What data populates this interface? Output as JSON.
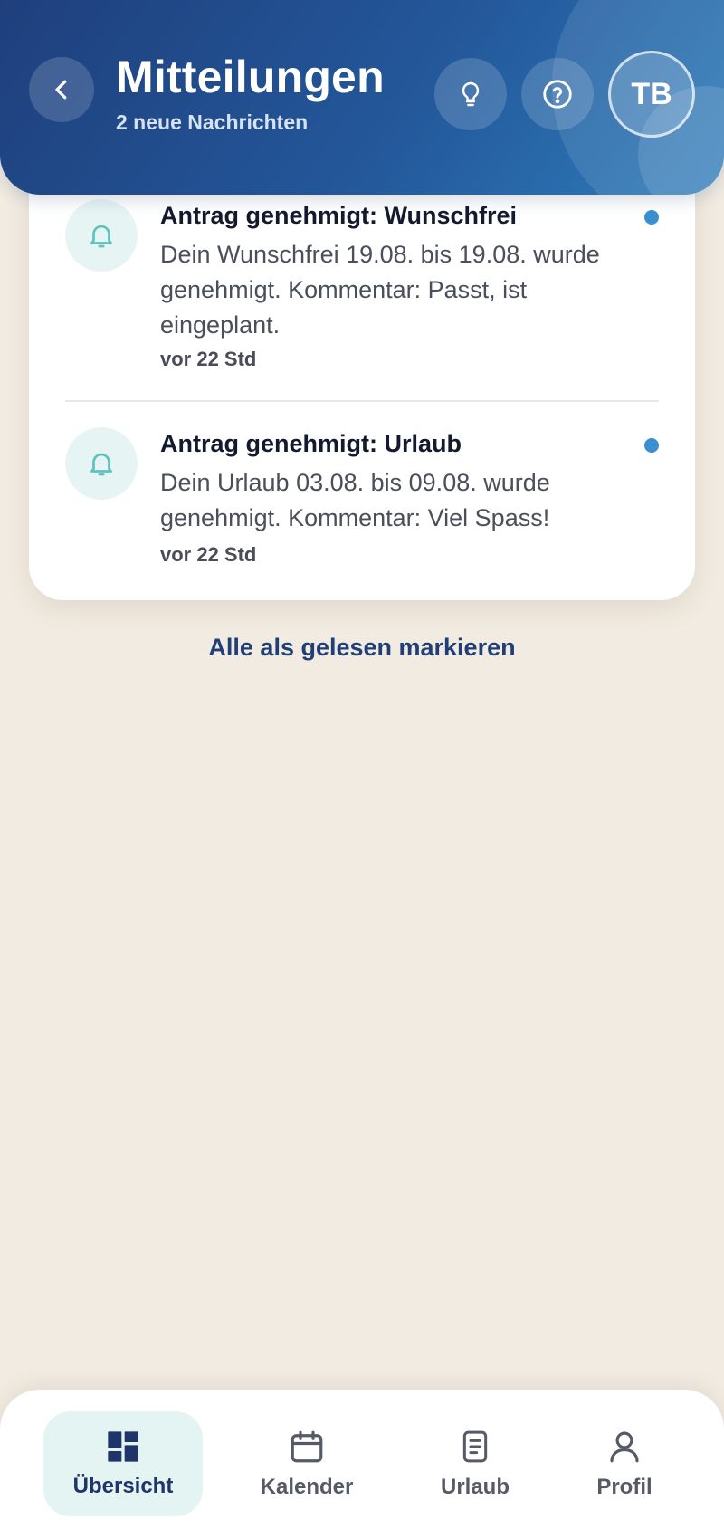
{
  "header": {
    "title": "Mitteilungen",
    "subtitle": "2 neue Nachrichten",
    "avatar_initials": "TB",
    "back_icon": "chevron-left-icon",
    "idea_icon": "lightbulb-icon",
    "help_icon": "help-circle-icon",
    "gradient_colors": [
      "#1f3f7c",
      "#2e7cba"
    ]
  },
  "notifications": [
    {
      "title": "Antrag genehmigt: Wunschfrei",
      "text": "Dein Wunschfrei 19.08. bis 19.08. wurde genehmigt. Kommentar: Passt, ist eingeplant.",
      "time": "vor 22 Std",
      "unread": true,
      "icon": "bell-icon"
    },
    {
      "title": "Antrag genehmigt: Urlaub",
      "text": "Dein Urlaub 03.08. bis 09.08. wurde genehmigt. Kommentar: Viel Spass!",
      "time": "vor 22 Std",
      "unread": true,
      "icon": "bell-icon"
    }
  ],
  "mark_all_label": "Alle als gelesen markieren",
  "nav": {
    "items": [
      {
        "label": "Übersicht",
        "icon": "dashboard-icon",
        "active": true
      },
      {
        "label": "Kalender",
        "icon": "calendar-icon",
        "active": false
      },
      {
        "label": "Urlaub",
        "icon": "document-icon",
        "active": false
      },
      {
        "label": "Profil",
        "icon": "user-icon",
        "active": false
      }
    ]
  },
  "colors": {
    "background": "#f1ebe1",
    "accent": "#213f76",
    "unread_dot": "#3a8fd1",
    "icon_teal": "#5cc3bd"
  }
}
